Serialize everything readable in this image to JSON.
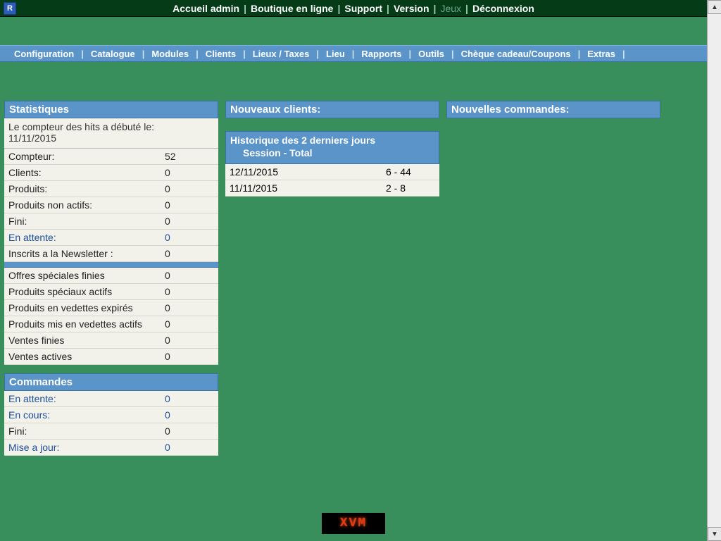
{
  "corner": "R",
  "topnav": {
    "items": [
      "Accueil admin",
      "Boutique en ligne",
      "Support",
      "Version",
      "Jeux",
      "Déconnexion"
    ],
    "inactive_index": 4
  },
  "subnav": {
    "items": [
      "Configuration",
      "Catalogue",
      "Modules",
      "Clients",
      "Lieux / Taxes",
      "Lieu",
      "Rapports",
      "Outils",
      "Chèque cadeau/Coupons",
      "Extras"
    ]
  },
  "stats": {
    "title": "Statistiques",
    "intro_line1": "Le compteur des hits a débuté le:",
    "intro_date": "11/11/2015",
    "rows1": [
      {
        "label": "Compteur:",
        "value": "52",
        "link": false
      },
      {
        "label": "Clients:",
        "value": "0",
        "link": false
      },
      {
        "label": "Produits:",
        "value": "0",
        "link": false
      },
      {
        "label": "Produits non actifs:",
        "value": "0",
        "link": false
      },
      {
        "label": "Fini:",
        "value": "0",
        "link": false
      },
      {
        "label": "En attente:",
        "value": "0",
        "link": true
      },
      {
        "label": "Inscrits a la Newsletter :",
        "value": "0",
        "link": false
      }
    ],
    "rows2": [
      {
        "label": "Offres spéciales finies",
        "value": "0",
        "link": false
      },
      {
        "label": "Produits spéciaux actifs",
        "value": "0",
        "link": false
      },
      {
        "label": "Produits en vedettes expirés",
        "value": "0",
        "link": false
      },
      {
        "label": "Produits mis en vedettes actifs",
        "value": "0",
        "link": false
      },
      {
        "label": "Ventes finies",
        "value": "0",
        "link": false
      },
      {
        "label": "Ventes actives",
        "value": "0",
        "link": false
      }
    ]
  },
  "orders": {
    "title": "Commandes",
    "rows": [
      {
        "label": "En attente:",
        "value": "0",
        "link": true
      },
      {
        "label": "En cours:",
        "value": "0",
        "link": true
      },
      {
        "label": "Fini:",
        "value": "0",
        "link": false
      },
      {
        "label": "Mise a jour:",
        "value": "0",
        "link": true
      }
    ]
  },
  "new_clients": {
    "title": "Nouveaux clients:",
    "sub_line1": "Historique des 2 derniers jours",
    "sub_line2": "Session - Total",
    "rows": [
      {
        "date": "12/11/2015",
        "value": "6 - 44"
      },
      {
        "date": "11/11/2015",
        "value": "2 - 8"
      }
    ]
  },
  "new_orders": {
    "title": "Nouvelles commandes:"
  },
  "footer_logo": "XVM"
}
